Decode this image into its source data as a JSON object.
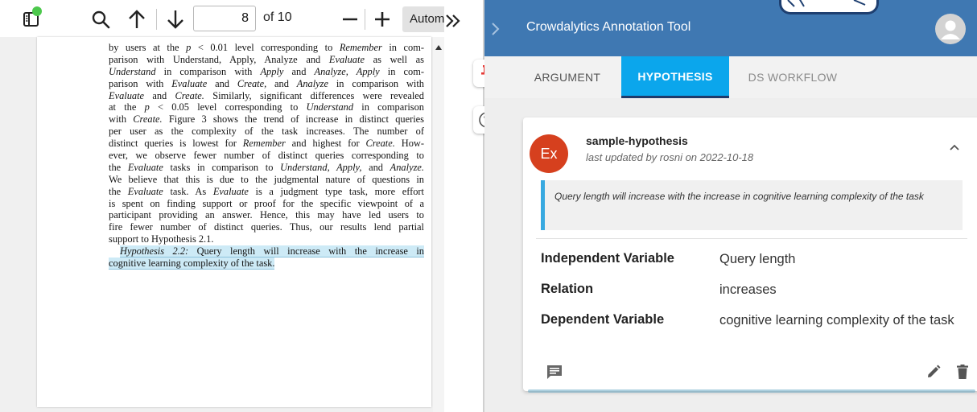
{
  "pdf_viewer": {
    "toolbar": {
      "page_number": "8",
      "page_of": "of 10",
      "zoom_label": "Automatic Zoom"
    },
    "page_lines": [
      {
        "segments": [
          {
            "t": "by users at the "
          },
          {
            "t": "p",
            "i": true
          },
          {
            "t": " < 0.01 level corresponding to "
          },
          {
            "t": "Remember",
            "i": true
          },
          {
            "t": " in com-"
          }
        ]
      },
      {
        "segments": [
          {
            "t": "parison with Understand, Apply, Analyze and "
          },
          {
            "t": "Evaluate",
            "i": true
          },
          {
            "t": " as well as"
          }
        ]
      },
      {
        "segments": [
          {
            "t": "Understand",
            "i": true
          },
          {
            "t": " in comparison with "
          },
          {
            "t": "Apply",
            "i": true
          },
          {
            "t": " and "
          },
          {
            "t": "Analyze, Apply",
            "i": true
          },
          {
            "t": " in com-"
          }
        ]
      },
      {
        "segments": [
          {
            "t": "parison with "
          },
          {
            "t": "Evaluate",
            "i": true
          },
          {
            "t": " and "
          },
          {
            "t": "Create,",
            "i": true
          },
          {
            "t": " and "
          },
          {
            "t": "Analyze",
            "i": true
          },
          {
            "t": " in comparison with"
          }
        ]
      },
      {
        "segments": [
          {
            "t": "Evaluate",
            "i": true
          },
          {
            "t": " and "
          },
          {
            "t": "Create.",
            "i": true
          },
          {
            "t": " Similarly, significant differences were revealed"
          }
        ]
      },
      {
        "segments": [
          {
            "t": "at the "
          },
          {
            "t": "p",
            "i": true
          },
          {
            "t": " < 0.05 level corresponding to "
          },
          {
            "t": "Understand",
            "i": true
          },
          {
            "t": " in comparison"
          }
        ]
      },
      {
        "segments": [
          {
            "t": "with "
          },
          {
            "t": "Create.",
            "i": true
          },
          {
            "t": " Figure 3 shows the trend of increase in distinct queries"
          }
        ]
      },
      {
        "segments": [
          {
            "t": "per user as the complexity of the task increases. The number of"
          }
        ]
      },
      {
        "segments": [
          {
            "t": "distinct queries is lowest for "
          },
          {
            "t": "Remember",
            "i": true
          },
          {
            "t": " and highest for "
          },
          {
            "t": "Create.",
            "i": true
          },
          {
            "t": " How-"
          }
        ]
      },
      {
        "segments": [
          {
            "t": "ever, we observe fewer number of distinct queries corresponding to"
          }
        ]
      },
      {
        "segments": [
          {
            "t": "the "
          },
          {
            "t": "Evaluate",
            "i": true
          },
          {
            "t": " tasks in comparison to "
          },
          {
            "t": "Understand, Apply,",
            "i": true
          },
          {
            "t": " and "
          },
          {
            "t": "Analyze.",
            "i": true
          }
        ]
      },
      {
        "segments": [
          {
            "t": "We believe that this is due to the judgmental nature of questions in"
          }
        ]
      },
      {
        "segments": [
          {
            "t": "the "
          },
          {
            "t": "Evaluate",
            "i": true
          },
          {
            "t": " task. As "
          },
          {
            "t": "Evaluate",
            "i": true
          },
          {
            "t": " is a judgment type task, more effort"
          }
        ]
      },
      {
        "segments": [
          {
            "t": "is spent on finding support or proof for the specific viewpoint of a"
          }
        ]
      },
      {
        "segments": [
          {
            "t": "participant providing an answer. Hence, this may have led users to"
          }
        ]
      },
      {
        "segments": [
          {
            "t": "fire fewer number of distinct queries. Thus, our results lend partial"
          }
        ]
      },
      {
        "last": true,
        "segments": [
          {
            "t": "support to Hypothesis 2.1."
          }
        ]
      },
      {
        "indent": true,
        "segments": [
          {
            "t": "Hypothesis 2.2:",
            "i": true,
            "h": true
          },
          {
            "t": " Query length will increase with the increase in",
            "h": true
          }
        ]
      },
      {
        "last": true,
        "segments": [
          {
            "t": "cognitive learning complexity of the task.",
            "h": true
          }
        ]
      }
    ]
  },
  "annotation_tool": {
    "title": "Crowdalytics Annotation Tool",
    "tabs": [
      {
        "label": "ARGUMENT",
        "active": false
      },
      {
        "label": "HYPOTHESIS",
        "active": true
      },
      {
        "label": "DS WORKFLOW",
        "active": false
      }
    ],
    "card": {
      "avatar_text": "Ex",
      "title": "sample-hypothesis",
      "subtitle": "last updated by rosni on 2022-10-18",
      "quote": "Query length will increase with the increase in cognitive learning complexity of the task",
      "properties": [
        {
          "label": "Independent Variable",
          "value": "Query length"
        },
        {
          "label": "Relation",
          "value": "increases"
        },
        {
          "label": "Dependent Variable",
          "value": "cognitive learning complexity of the task"
        }
      ]
    },
    "colors": {
      "header": "#3f78b2",
      "active_tab": "#0ba6ec",
      "avatar": "#d6401e",
      "quote_border": "#38a9e0",
      "pin": "#e53935"
    }
  }
}
